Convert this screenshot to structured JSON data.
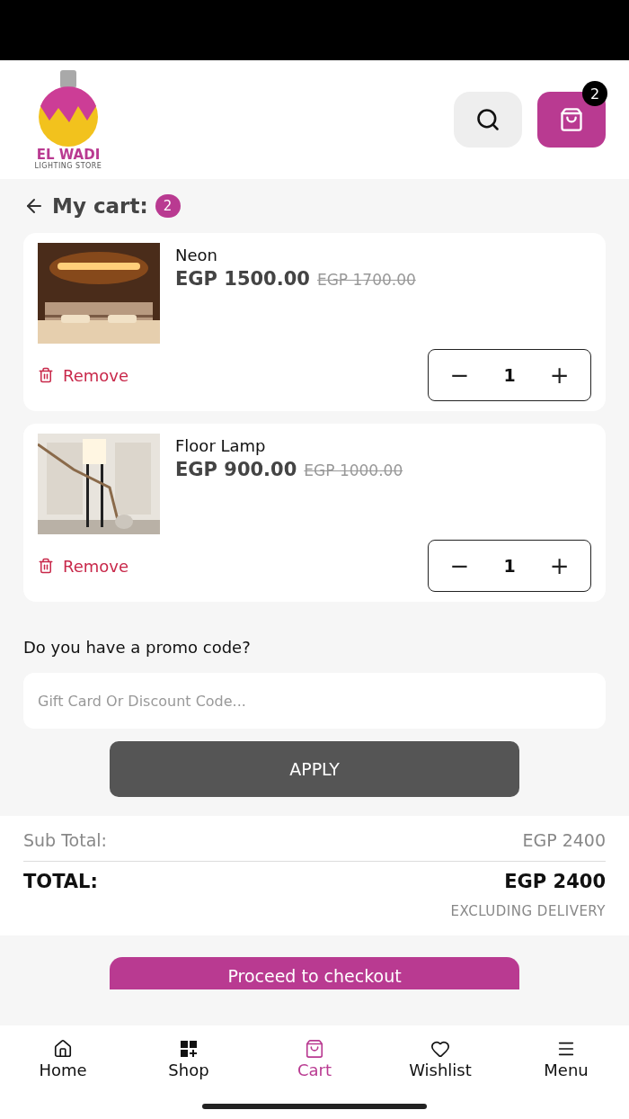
{
  "header": {
    "logo": {
      "name": "EL WADI",
      "tagline": "LIGHTING STORE"
    },
    "cart_badge": "2"
  },
  "cart": {
    "title": "My cart:",
    "count": "2",
    "items": [
      {
        "name": "Neon",
        "price": "EGP 1500.00",
        "old_price": "EGP 1700.00",
        "remove": "Remove",
        "quantity": "1",
        "minus": "−",
        "plus": "+"
      },
      {
        "name": "Floor Lamp",
        "price": "EGP 900.00",
        "old_price": "EGP 1000.00",
        "remove": "Remove",
        "quantity": "1",
        "minus": "−",
        "plus": "+"
      }
    ]
  },
  "promo": {
    "question": "Do you have a promo code?",
    "placeholder": "Gift Card Or Discount Code...",
    "apply": "APPLY"
  },
  "totals": {
    "subtotal_label": "Sub Total:",
    "subtotal": "EGP 2400",
    "total_label": "TOTAL:",
    "total": "EGP 2400",
    "note": "EXCLUDING DELIVERY"
  },
  "checkout": "Proceed to checkout",
  "nav": [
    {
      "label": "Home",
      "selected": false
    },
    {
      "label": "Shop",
      "selected": false
    },
    {
      "label": "Cart",
      "selected": true
    },
    {
      "label": "Wishlist",
      "selected": false
    },
    {
      "label": "Menu",
      "selected": false
    }
  ]
}
